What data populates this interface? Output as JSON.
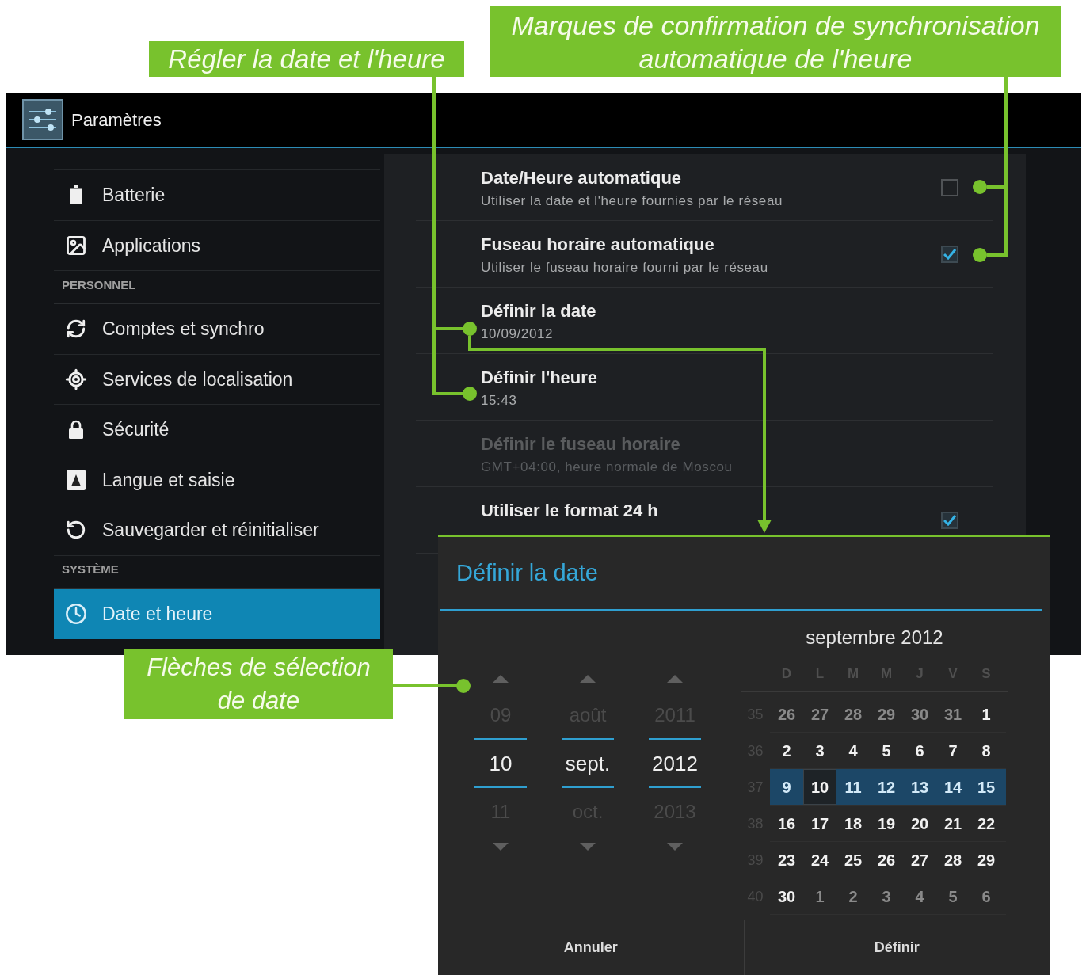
{
  "annotations": [
    {
      "text": "Régler la date et l'heure"
    },
    {
      "text": "Marques de confirmation de synchronisation automatique de l'heure"
    },
    {
      "text": "Flèches de sélection de date"
    }
  ],
  "action_bar": {
    "title": "Paramètres"
  },
  "sidebar": {
    "sections": [
      {
        "items": [
          {
            "label": "Batterie",
            "selected": false
          },
          {
            "label": "Applications",
            "selected": false
          }
        ]
      },
      {
        "header": "PERSONNEL",
        "items": [
          {
            "label": "Comptes et synchro",
            "selected": false
          },
          {
            "label": "Services de localisation",
            "selected": false
          },
          {
            "label": "Sécurité",
            "selected": false
          },
          {
            "label": "Langue et saisie",
            "selected": false
          },
          {
            "label": "Sauvegarder et réinitialiser",
            "selected": false
          }
        ]
      },
      {
        "header": "SYSTÈME",
        "items": [
          {
            "label": "Date et heure",
            "selected": true
          }
        ]
      }
    ]
  },
  "settings": {
    "rows": [
      {
        "kind": "checkbox",
        "title": "Date/Heure automatique",
        "subtitle": "Utiliser la date et l'heure fournies par le réseau",
        "checked": false,
        "disabled": false
      },
      {
        "kind": "checkbox",
        "title": "Fuseau horaire automatique",
        "subtitle": "Utiliser le fuseau horaire fourni par le réseau",
        "checked": true,
        "disabled": false
      },
      {
        "kind": "plain",
        "title": "Définir la date",
        "subtitle": "10/09/2012",
        "disabled": false
      },
      {
        "kind": "plain",
        "title": "Définir l'heure",
        "subtitle": "15:43",
        "disabled": false
      },
      {
        "kind": "plain",
        "title": "Définir le fuseau horaire",
        "subtitle": "GMT+04:00, heure normale de Moscou",
        "disabled": true
      },
      {
        "kind": "checkbox",
        "title": "Utiliser le format 24 h",
        "checked": true,
        "disabled": false
      }
    ]
  },
  "dialog": {
    "title": "Définir la date",
    "spinners": [
      {
        "prev": "09",
        "value": "10",
        "next": "11"
      },
      {
        "prev": "août",
        "value": "sept.",
        "next": "oct."
      },
      {
        "prev": "2011",
        "value": "2012",
        "next": "2013"
      }
    ],
    "calendar": {
      "title": "septembre 2012",
      "weekdays": [
        "D",
        "L",
        "M",
        "M",
        "J",
        "V",
        "S"
      ],
      "weeks": [
        {
          "number": "35",
          "selected": false,
          "days": [
            {
              "label": "26",
              "in_month": false,
              "selected": false
            },
            {
              "label": "27",
              "in_month": false,
              "selected": false
            },
            {
              "label": "28",
              "in_month": false,
              "selected": false
            },
            {
              "label": "29",
              "in_month": false,
              "selected": false
            },
            {
              "label": "30",
              "in_month": false,
              "selected": false
            },
            {
              "label": "31",
              "in_month": false,
              "selected": false
            },
            {
              "label": "1",
              "in_month": true,
              "selected": false
            }
          ]
        },
        {
          "number": "36",
          "selected": false,
          "days": [
            {
              "label": "2",
              "in_month": true,
              "selected": false
            },
            {
              "label": "3",
              "in_month": true,
              "selected": false
            },
            {
              "label": "4",
              "in_month": true,
              "selected": false
            },
            {
              "label": "5",
              "in_month": true,
              "selected": false
            },
            {
              "label": "6",
              "in_month": true,
              "selected": false
            },
            {
              "label": "7",
              "in_month": true,
              "selected": false
            },
            {
              "label": "8",
              "in_month": true,
              "selected": false
            }
          ]
        },
        {
          "number": "37",
          "selected": true,
          "days": [
            {
              "label": "9",
              "in_month": true,
              "selected": false
            },
            {
              "label": "10",
              "in_month": true,
              "selected": true
            },
            {
              "label": "11",
              "in_month": true,
              "selected": false
            },
            {
              "label": "12",
              "in_month": true,
              "selected": false
            },
            {
              "label": "13",
              "in_month": true,
              "selected": false
            },
            {
              "label": "14",
              "in_month": true,
              "selected": false
            },
            {
              "label": "15",
              "in_month": true,
              "selected": false
            }
          ]
        },
        {
          "number": "38",
          "selected": false,
          "days": [
            {
              "label": "16",
              "in_month": true,
              "selected": false
            },
            {
              "label": "17",
              "in_month": true,
              "selected": false
            },
            {
              "label": "18",
              "in_month": true,
              "selected": false
            },
            {
              "label": "19",
              "in_month": true,
              "selected": false
            },
            {
              "label": "20",
              "in_month": true,
              "selected": false
            },
            {
              "label": "21",
              "in_month": true,
              "selected": false
            },
            {
              "label": "22",
              "in_month": true,
              "selected": false
            }
          ]
        },
        {
          "number": "39",
          "selected": false,
          "days": [
            {
              "label": "23",
              "in_month": true,
              "selected": false
            },
            {
              "label": "24",
              "in_month": true,
              "selected": false
            },
            {
              "label": "25",
              "in_month": true,
              "selected": false
            },
            {
              "label": "26",
              "in_month": true,
              "selected": false
            },
            {
              "label": "27",
              "in_month": true,
              "selected": false
            },
            {
              "label": "28",
              "in_month": true,
              "selected": false
            },
            {
              "label": "29",
              "in_month": true,
              "selected": false
            }
          ]
        },
        {
          "number": "40",
          "selected": false,
          "days": [
            {
              "label": "30",
              "in_month": true,
              "selected": false
            },
            {
              "label": "1",
              "in_month": false,
              "selected": false
            },
            {
              "label": "2",
              "in_month": false,
              "selected": false
            },
            {
              "label": "3",
              "in_month": false,
              "selected": false
            },
            {
              "label": "4",
              "in_month": false,
              "selected": false
            },
            {
              "label": "5",
              "in_month": false,
              "selected": false
            },
            {
              "label": "6",
              "in_month": false,
              "selected": false
            }
          ]
        }
      ]
    },
    "buttons": [
      "Annuler",
      "Définir"
    ]
  }
}
